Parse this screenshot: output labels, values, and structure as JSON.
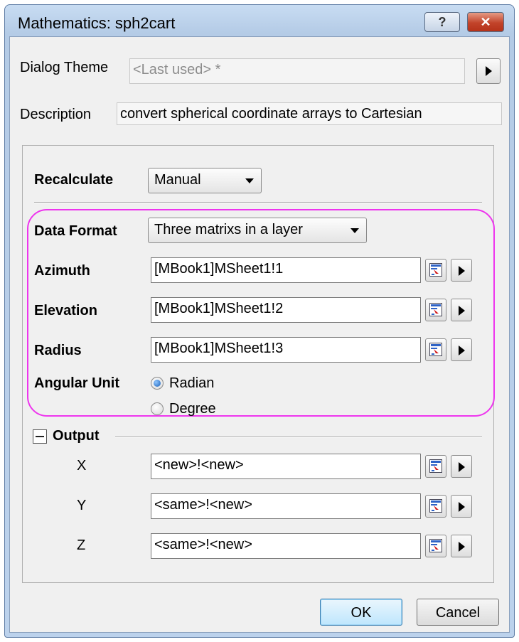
{
  "window": {
    "title": "Mathematics: sph2cart",
    "help_label": "?",
    "close_label": "✕"
  },
  "dialog_theme": {
    "label": "Dialog Theme",
    "value": "<Last used> *"
  },
  "description": {
    "label": "Description",
    "value": "convert spherical coordinate arrays to Cartesian"
  },
  "recalculate": {
    "label": "Recalculate",
    "value": "Manual"
  },
  "data_format": {
    "label": "Data Format",
    "value": "Three matrixs in a layer"
  },
  "inputs": [
    {
      "label": "Azimuth",
      "value": "[MBook1]MSheet1!1"
    },
    {
      "label": "Elevation",
      "value": "[MBook1]MSheet1!2"
    },
    {
      "label": "Radius",
      "value": "[MBook1]MSheet1!3"
    }
  ],
  "angular_unit": {
    "label": "Angular Unit",
    "options": [
      "Radian",
      "Degree"
    ],
    "selected": "Radian"
  },
  "output": {
    "label": "Output",
    "items": [
      {
        "label": "X",
        "value": "<new>!<new>"
      },
      {
        "label": "Y",
        "value": "<same>!<new>"
      },
      {
        "label": "Z",
        "value": "<same>!<new>"
      }
    ]
  },
  "buttons": {
    "ok": "OK",
    "cancel": "Cancel"
  },
  "colors": {
    "highlight": "#ee35ee",
    "close": "#c2432a",
    "radio_selected": "#1a5fb8"
  },
  "icons": {
    "select": "select-range-icon",
    "menu": "play-arrow-icon"
  }
}
